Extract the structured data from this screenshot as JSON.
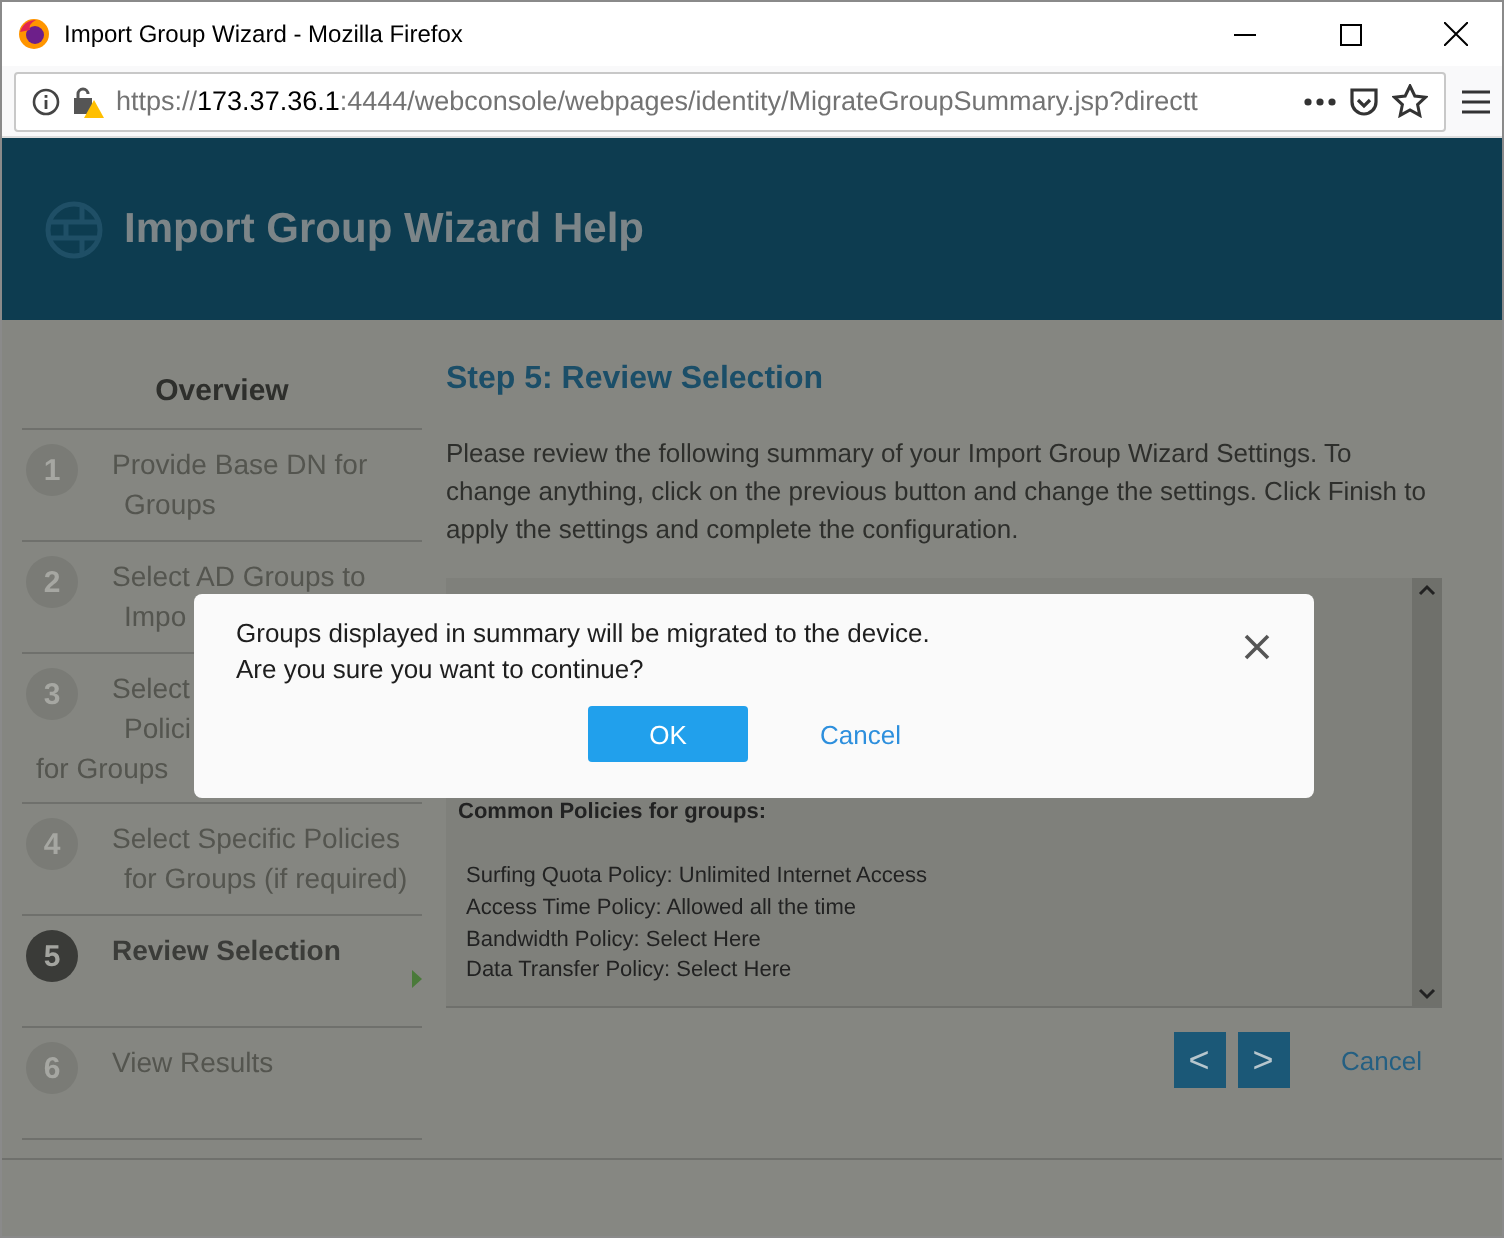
{
  "window": {
    "title": "Import Group Wizard - Mozilla Firefox"
  },
  "address_bar": {
    "scheme": "https://",
    "host": "173.37.36.1",
    "rest": ":4444/webconsole/webpages/identity/MigrateGroupSummary.jsp?directt"
  },
  "header": {
    "title": "Import Group Wizard Help"
  },
  "sidebar": {
    "title": "Overview",
    "steps": [
      {
        "number": "1",
        "lines": [
          "Provide Base DN for",
          "Groups"
        ],
        "selected": false
      },
      {
        "number": "2",
        "lines": [
          "Select AD Groups to",
          "Impo"
        ],
        "selected": false
      },
      {
        "number": "3",
        "lines": [
          "Select",
          "Polici"
        ],
        "tail": "for Groups",
        "selected": false
      },
      {
        "number": "4",
        "lines": [
          "Select Specific Policies",
          "for Groups (if required)"
        ],
        "selected": false
      },
      {
        "number": "5",
        "lines": [
          "Review Selection"
        ],
        "selected": true
      },
      {
        "number": "6",
        "lines": [
          "View Results"
        ],
        "selected": false
      }
    ]
  },
  "content": {
    "title": "Step 5: Review Selection",
    "intro": "Please review the following summary of your Import Group Wizard Settings. To change anything, click on the previous button and change the settings. Click Finish to apply the settings and complete the configuration.",
    "summary": {
      "heading": "Common Policies for groups:",
      "lines": [
        "Surfing Quota Policy: Unlimited Internet Access",
        "Access Time Policy: Allowed all the time",
        "Bandwidth Policy: Select Here",
        "Data Transfer Policy: Select Here"
      ]
    },
    "nav_buttons": [
      "<",
      ">"
    ],
    "cancel": "Cancel"
  },
  "dialog": {
    "message_lines": [
      "Groups displayed in summary will be migrated to the device.",
      "Are you sure you want to continue?"
    ],
    "ok": "OK",
    "cancel": "Cancel"
  }
}
